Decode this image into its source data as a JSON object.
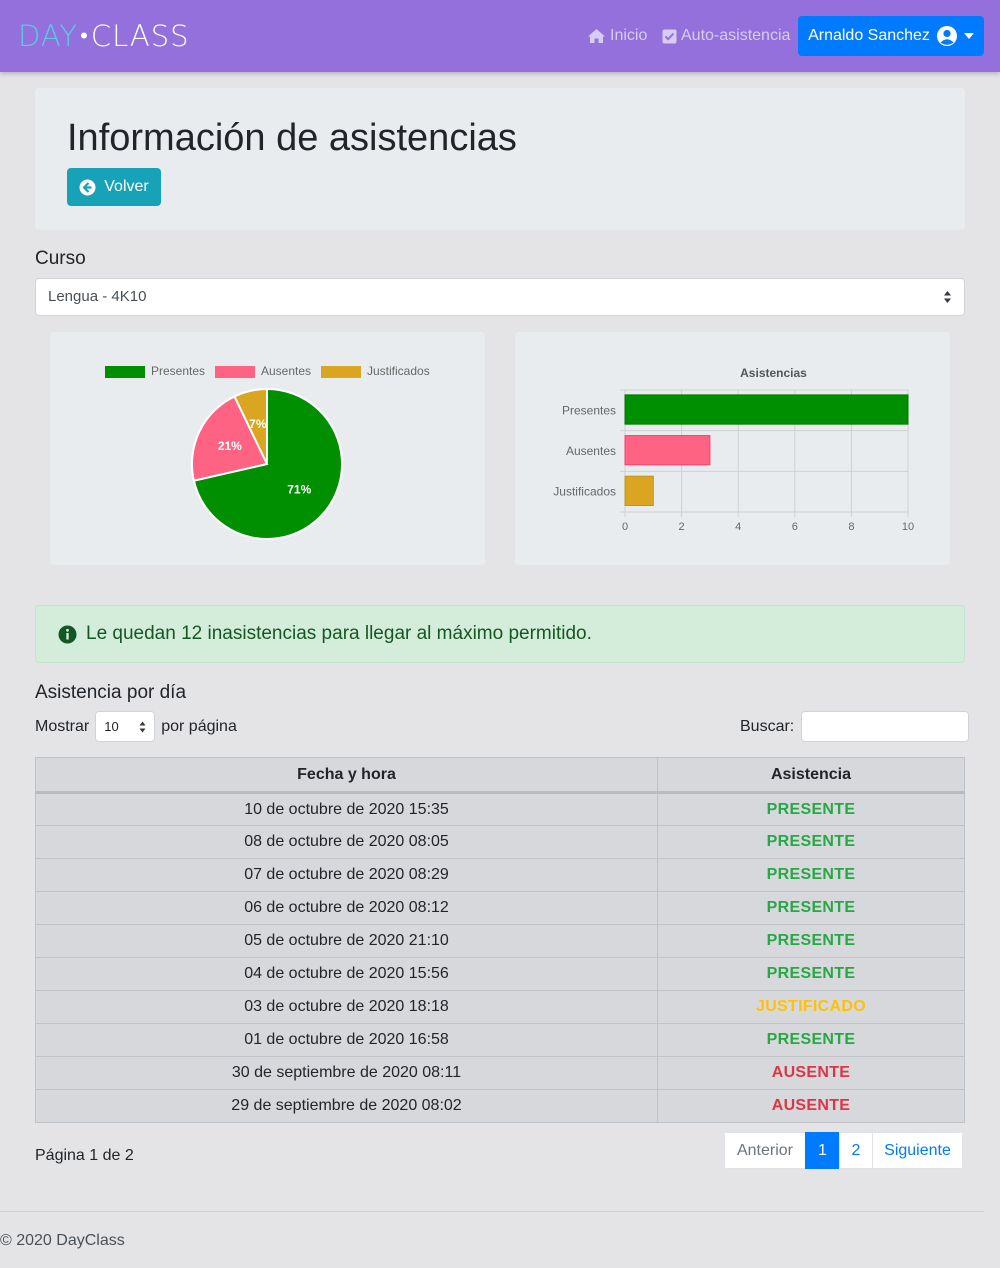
{
  "navbar": {
    "brand_day": "DAY",
    "brand_class": "CLASS",
    "inicio": "Inicio",
    "auto_asistencia": "Auto-asistencia",
    "user": "Arnaldo Sanchez"
  },
  "header": {
    "title": "Información de asistencias",
    "back_label": "Volver"
  },
  "curso": {
    "label": "Curso",
    "selected": "Lengua - 4K10"
  },
  "alert": {
    "text": "Le quedan 12 inasistencias para llegar al máximo permitido."
  },
  "attendance": {
    "heading": "Asistencia por día",
    "show_prefix": "Mostrar",
    "page_size": "10",
    "show_suffix": "por página",
    "search_label": "Buscar:",
    "columns": [
      "Fecha y hora",
      "Asistencia"
    ],
    "rows": [
      {
        "date": "10 de octubre de 2020 15:35",
        "status": "PRESENTE"
      },
      {
        "date": "08 de octubre de 2020 08:05",
        "status": "PRESENTE"
      },
      {
        "date": "07 de octubre de 2020 08:29",
        "status": "PRESENTE"
      },
      {
        "date": "06 de octubre de 2020 08:12",
        "status": "PRESENTE"
      },
      {
        "date": "05 de octubre de 2020 21:10",
        "status": "PRESENTE"
      },
      {
        "date": "04 de octubre de 2020 15:56",
        "status": "PRESENTE"
      },
      {
        "date": "03 de octubre de 2020 18:18",
        "status": "JUSTIFICADO"
      },
      {
        "date": "01 de octubre de 2020 16:58",
        "status": "PRESENTE"
      },
      {
        "date": "30 de septiembre de 2020 08:11",
        "status": "AUSENTE"
      },
      {
        "date": "29 de septiembre de 2020 08:02",
        "status": "AUSENTE"
      }
    ],
    "status_colors": {
      "PRESENTE": "#28a745",
      "JUSTIFICADO": "#ffc107",
      "AUSENTE": "#dc3545"
    },
    "page_info": "Página 1 de 2",
    "pager": {
      "prev": "Anterior",
      "pages": [
        "1",
        "2"
      ],
      "next": "Siguiente"
    }
  },
  "footer": {
    "text": "© 2020 DayClass"
  },
  "chart_data": [
    {
      "type": "pie",
      "categories": [
        "Presentes",
        "Ausentes",
        "Justificados"
      ],
      "values": [
        10,
        3,
        1
      ],
      "labels": [
        "71%",
        "21%",
        "7%"
      ],
      "colors": [
        "#008f00",
        "#ff6384",
        "#daa520"
      ],
      "legend": "top"
    },
    {
      "type": "bar",
      "orientation": "horizontal",
      "title": "Asistencias",
      "categories": [
        "Presentes",
        "Ausentes",
        "Justificados"
      ],
      "values": [
        10,
        3,
        1
      ],
      "colors": [
        "#008f00",
        "#ff6384",
        "#daa520"
      ],
      "xlim": [
        0,
        10
      ],
      "xticks": [
        "0",
        "2",
        "4",
        "6",
        "8",
        "10"
      ],
      "grid": true
    }
  ]
}
